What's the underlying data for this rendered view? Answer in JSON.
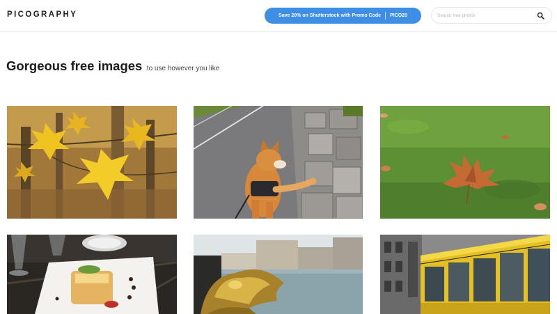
{
  "header": {
    "logo": "PICOGRAPHY",
    "promo_text": "Save 20% on Shutterstock with Promo Code",
    "promo_code": "PICO20",
    "search_placeholder": "Search free photos",
    "search_icon": "search-icon"
  },
  "intro": {
    "title": "Gorgeous free images",
    "subtitle": "to use however you like"
  },
  "photos": [
    {
      "subject": "yellow autumn leaves"
    },
    {
      "subject": "shiba inu dog on road wall"
    },
    {
      "subject": "fallen leaf on grass"
    },
    {
      "subject": "plated food dish"
    },
    {
      "subject": "golden sculpture by water"
    },
    {
      "subject": "yellow tram on city street"
    }
  ],
  "colors": {
    "accent": "#3f8ee6",
    "text": "#1c1c1c"
  }
}
